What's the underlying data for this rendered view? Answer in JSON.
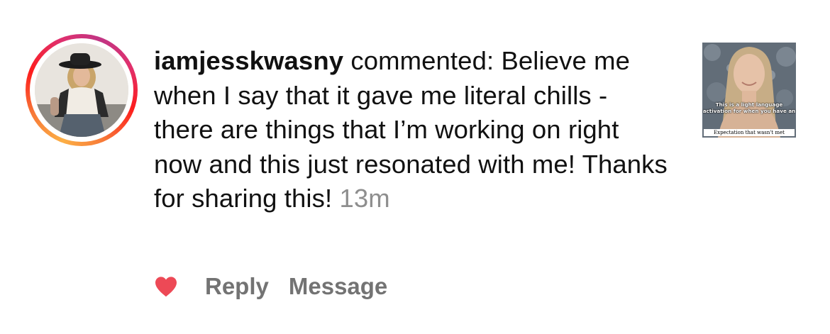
{
  "comment": {
    "username": "iamjesskwasny",
    "verb": " commented: ",
    "body": "Believe me when I say that it gave me literal chills - there are things that I’m working on right now and this just resonated with me! Thanks for sharing this!",
    "time": "13m"
  },
  "actions": {
    "reply_label": "Reply",
    "message_label": "Message",
    "like_icon": "heart-icon",
    "like_color": "#ed4956"
  },
  "thumbnail": {
    "caption": "This is a light language activation for when you have an",
    "banner": "Expectation that wasn't met"
  }
}
